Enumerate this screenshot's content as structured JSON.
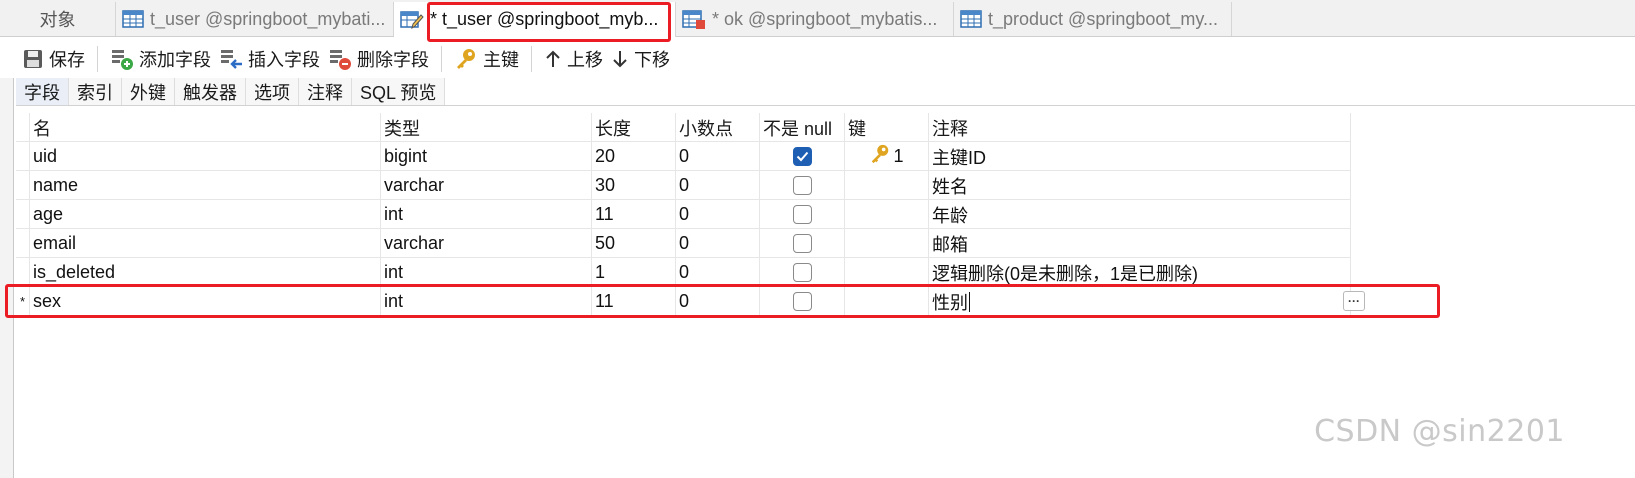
{
  "tabs": [
    {
      "label": "对象",
      "icon": "objects",
      "active": false
    },
    {
      "label": "t_user @springboot_mybati...",
      "icon": "table-icon",
      "active": false
    },
    {
      "label": "* t_user @springboot_myb...",
      "icon": "table-design-icon",
      "active": true
    },
    {
      "label": "* ok @springboot_mybatis...",
      "icon": "table-data-icon",
      "active": false
    },
    {
      "label": "t_product @springboot_my...",
      "icon": "table-icon",
      "active": false
    }
  ],
  "toolbar": {
    "save": "保存",
    "add_field": "添加字段",
    "insert_field": "插入字段",
    "delete_field": "删除字段",
    "primary_key": "主键",
    "move_up": "上移",
    "move_down": "下移"
  },
  "subtabs": [
    "字段",
    "索引",
    "外键",
    "触发器",
    "选项",
    "注释",
    "SQL 预览"
  ],
  "columns": [
    "名",
    "类型",
    "长度",
    "小数点",
    "不是 null",
    "键",
    "注释"
  ],
  "rows": [
    {
      "marker": "",
      "name": "uid",
      "type": "bigint",
      "length": "20",
      "decimals": "0",
      "not_null": true,
      "key": "1",
      "comment": "主键ID"
    },
    {
      "marker": "",
      "name": "name",
      "type": "varchar",
      "length": "30",
      "decimals": "0",
      "not_null": false,
      "key": "",
      "comment": "姓名"
    },
    {
      "marker": "",
      "name": "age",
      "type": "int",
      "length": "11",
      "decimals": "0",
      "not_null": false,
      "key": "",
      "comment": "年龄"
    },
    {
      "marker": "",
      "name": "email",
      "type": "varchar",
      "length": "50",
      "decimals": "0",
      "not_null": false,
      "key": "",
      "comment": "邮箱"
    },
    {
      "marker": "",
      "name": "is_deleted",
      "type": "int",
      "length": "1",
      "decimals": "0",
      "not_null": false,
      "key": "",
      "comment": "逻辑删除(0是未删除，1是已删除)"
    },
    {
      "marker": "*",
      "name": "sex",
      "type": "int",
      "length": "11",
      "decimals": "0",
      "not_null": false,
      "key": "",
      "comment": "性别"
    }
  ],
  "ellipsis_label": "···",
  "watermark": "CSDN @sin2201",
  "colors": {
    "highlight": "#ec1c24",
    "checkbox_on": "#1e5fb3",
    "key_gold": "#e0a520"
  }
}
